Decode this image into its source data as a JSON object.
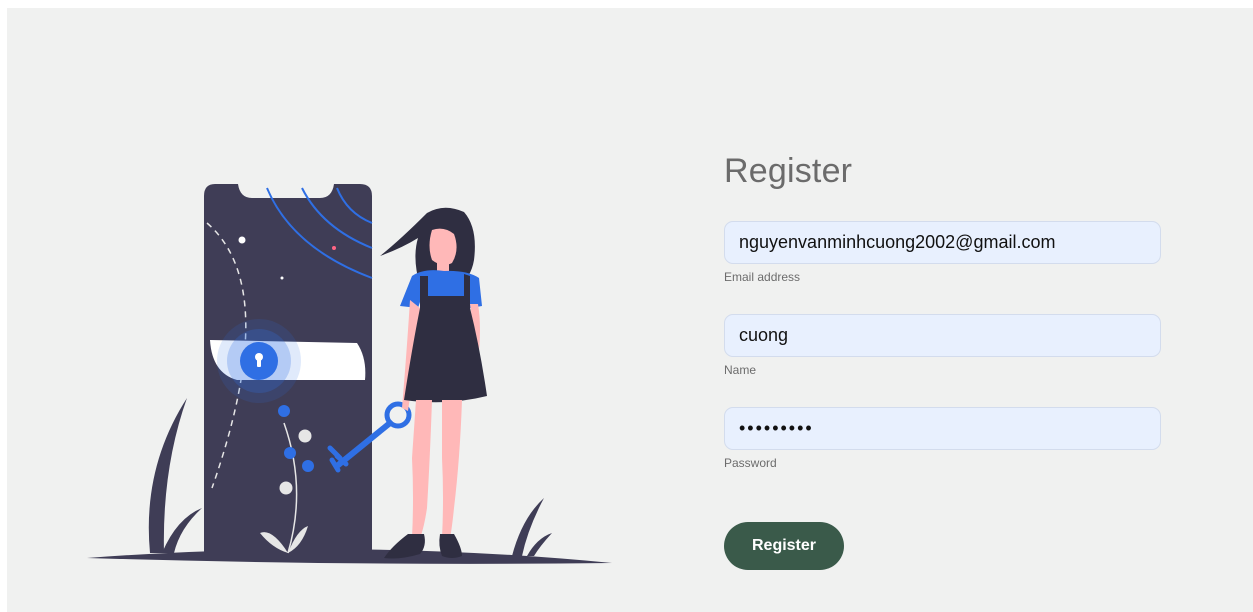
{
  "form": {
    "title": "Register",
    "email": {
      "value": "nguyenvanminhcuong2002@gmail.com",
      "label": "Email address"
    },
    "name": {
      "value": "cuong",
      "label": "Name"
    },
    "password": {
      "value": "cuong2002",
      "label": "Password"
    },
    "submit_label": "Register"
  },
  "illustration": {
    "icon": "login-illustration"
  },
  "colors": {
    "background": "#f0f1f0",
    "input_background": "#e8f0fe",
    "button": "#3a5a4a",
    "phone": "#3f3d56",
    "accent": "#2f6fe4"
  }
}
